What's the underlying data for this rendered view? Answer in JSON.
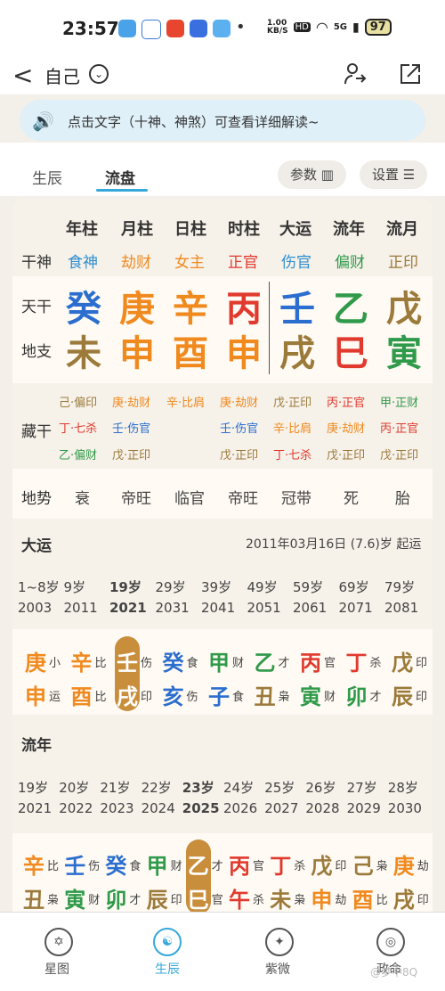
{
  "status_bar": {
    "time": "23:57",
    "speed": "1.00\nKB/S",
    "hd": "HD",
    "net": "5G",
    "battery": "97"
  },
  "nav": {
    "back": "<",
    "title": "自己",
    "chevron": "⌄"
  },
  "banner": {
    "text": "点击文字（十神、神煞）可查看详细解读~"
  },
  "tabs": {
    "birth": "生辰",
    "flow": "流盘",
    "params": "参数",
    "settings": "设置"
  },
  "chart": {
    "headers": [
      "年柱",
      "月柱",
      "日柱",
      "时柱",
      "大运",
      "流年",
      "流月"
    ],
    "row_labels": {
      "ten_god": "干神",
      "tiangan": "天干",
      "dizhi": "地支",
      "canggan": "藏干",
      "dishi": "地势"
    },
    "ten_gods": [
      "食神",
      "劫财",
      "女主",
      "正官",
      "伤官",
      "偏财",
      "正印"
    ],
    "tiangan": [
      "癸",
      "庚",
      "辛",
      "丙",
      "壬",
      "乙",
      "戊"
    ],
    "dizhi": [
      "未",
      "申",
      "酉",
      "申",
      "戌",
      "巳",
      "寅"
    ],
    "canggan": [
      [
        "己·偏印",
        "丁·七杀",
        "乙·偏财"
      ],
      [
        "庚·劫财",
        "壬·伤官",
        "戊·正印"
      ],
      [
        "辛·比肩"
      ],
      [
        "庚·劫财",
        "壬·伤官",
        "戊·正印"
      ],
      [
        "戊·正印",
        "辛·比肩",
        "丁·七杀"
      ],
      [
        "丙·正官",
        "庚·劫财",
        "戊·正印"
      ],
      [
        "甲·正财",
        "丙·正官",
        "戊·正印"
      ]
    ],
    "dishi": [
      "衰",
      "帝旺",
      "临官",
      "帝旺",
      "冠带",
      "死",
      "胎"
    ]
  },
  "dayun": {
    "title": "大运",
    "start": "2011年03月16日 (7.6)岁 起运",
    "ages": [
      "1~8岁",
      "9岁",
      "19岁",
      "29岁",
      "39岁",
      "49岁",
      "59岁",
      "69岁",
      "79岁"
    ],
    "years": [
      "2003",
      "2011",
      "2021",
      "2031",
      "2041",
      "2051",
      "2061",
      "2071",
      "2081"
    ],
    "gan": [
      [
        "庚",
        "小"
      ],
      [
        "辛",
        "比"
      ],
      [
        "壬",
        "伤"
      ],
      [
        "癸",
        "食"
      ],
      [
        "甲",
        "财"
      ],
      [
        "乙",
        "才"
      ],
      [
        "丙",
        "官"
      ],
      [
        "丁",
        "杀"
      ],
      [
        "戊",
        "印"
      ]
    ],
    "zhi": [
      [
        "申",
        "运"
      ],
      [
        "酉",
        "比"
      ],
      [
        "戌",
        "印"
      ],
      [
        "亥",
        "伤"
      ],
      [
        "子",
        "食"
      ],
      [
        "丑",
        "枭"
      ],
      [
        "寅",
        "财"
      ],
      [
        "卯",
        "才"
      ],
      [
        "辰",
        "印"
      ]
    ]
  },
  "liunian": {
    "title": "流年",
    "ages": [
      "19岁",
      "20岁",
      "21岁",
      "22岁",
      "23岁",
      "24岁",
      "25岁",
      "26岁",
      "27岁",
      "28岁"
    ],
    "years": [
      "2021",
      "2022",
      "2023",
      "2024",
      "2025",
      "2026",
      "2027",
      "2028",
      "2029",
      "2030"
    ],
    "gan": [
      [
        "辛",
        "比"
      ],
      [
        "壬",
        "伤"
      ],
      [
        "癸",
        "食"
      ],
      [
        "甲",
        "财"
      ],
      [
        "乙",
        "才"
      ],
      [
        "丙",
        "官"
      ],
      [
        "丁",
        "杀"
      ],
      [
        "戊",
        "印"
      ],
      [
        "己",
        "枭"
      ],
      [
        "庚",
        "劫"
      ]
    ],
    "zhi": [
      [
        "丑",
        "枭"
      ],
      [
        "寅",
        "财"
      ],
      [
        "卯",
        "才"
      ],
      [
        "辰",
        "印"
      ],
      [
        "巳",
        "官"
      ],
      [
        "午",
        "杀"
      ],
      [
        "未",
        "枭"
      ],
      [
        "申",
        "劫"
      ],
      [
        "酉",
        "比"
      ],
      [
        "戌",
        "印"
      ]
    ]
  },
  "bottom_nav": [
    "星图",
    "生辰",
    "紫微",
    "政命"
  ],
  "watermark": "@梦中8Q"
}
